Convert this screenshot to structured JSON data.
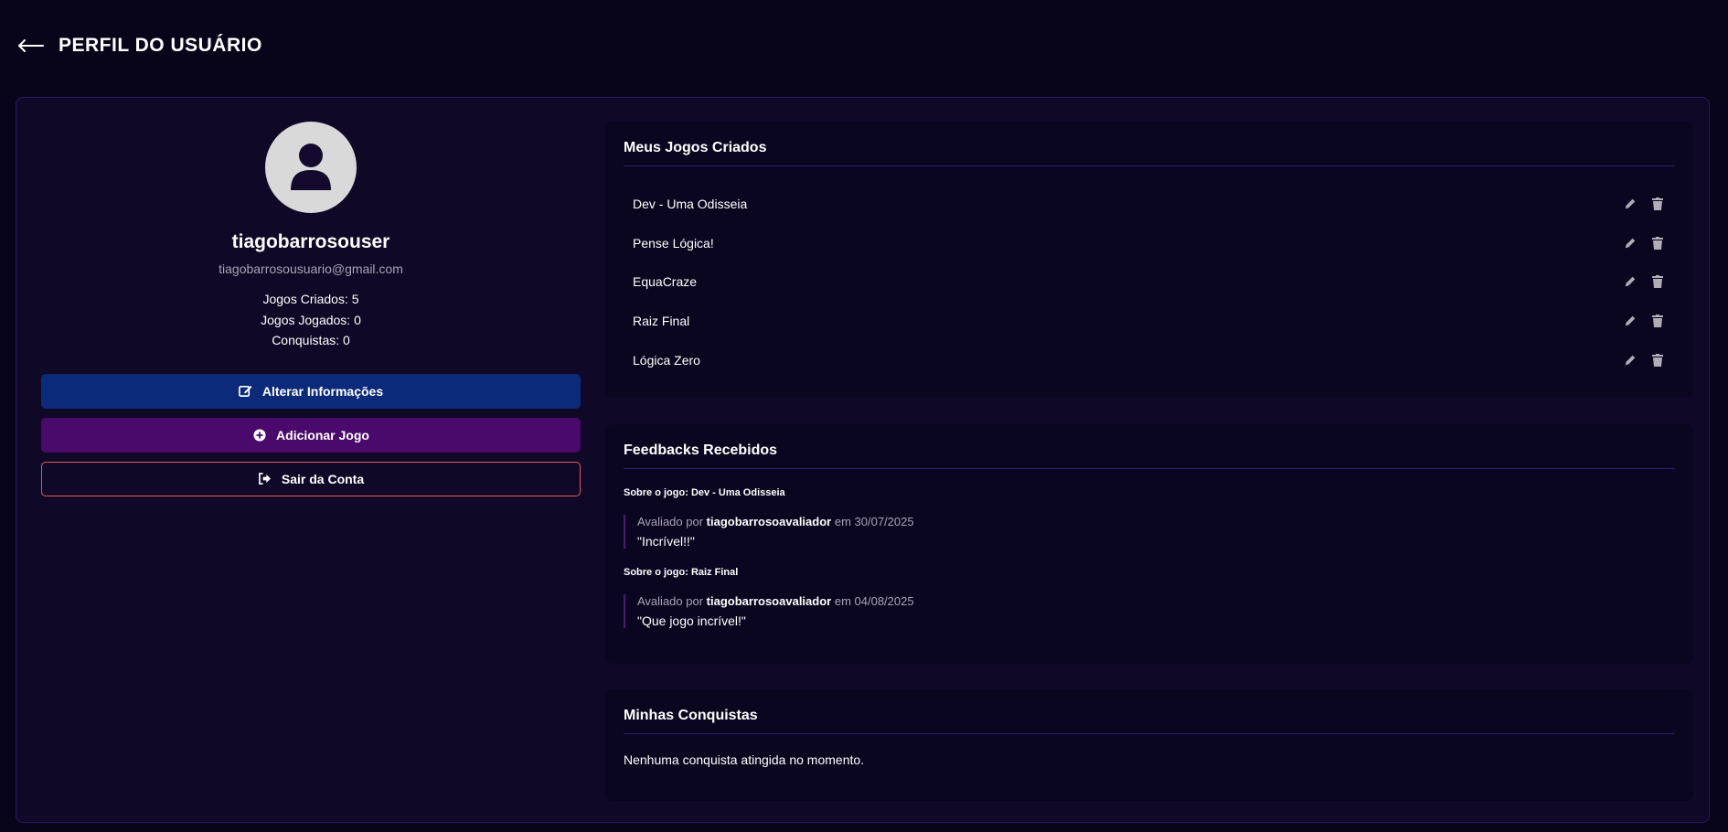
{
  "header": {
    "title": "PERFIL DO USUÁRIO"
  },
  "profile": {
    "username": "tiagobarrosouser",
    "email": "tiagobarrosousuario@gmail.com",
    "stats": {
      "created": "Jogos Criados: 5",
      "played": "Jogos Jogados: 0",
      "achievements": "Conquistas: 0"
    },
    "buttons": {
      "edit": "Alterar Informações",
      "add": "Adicionar Jogo",
      "logout": "Sair da Conta"
    }
  },
  "my_games": {
    "title": "Meus Jogos Criados",
    "items": [
      "Dev - Uma Odisseia",
      "Pense Lógica!",
      "EquaCraze",
      "Raiz Final",
      "Lógica Zero"
    ]
  },
  "feedbacks": {
    "title": "Feedbacks Recebidos",
    "groups": [
      {
        "about": "Sobre o jogo: Dev - Uma Odisseia",
        "prefix": "Avaliado por",
        "author": "tiagobarrosoavaliador",
        "date": "em 30/07/2025",
        "text": "\"Incrível!!\""
      },
      {
        "about": "Sobre o jogo: Raiz Final",
        "prefix": "Avaliado por",
        "author": "tiagobarrosoavaliador",
        "date": "em 04/08/2025",
        "text": "\"Que jogo incrível!\""
      }
    ]
  },
  "achievements": {
    "title": "Minhas Conquistas",
    "empty": "Nenhuma conquista atingida no momento."
  },
  "icons": {
    "back": "arrow-left-icon",
    "avatar": "user-icon",
    "edit": "pen-square-icon",
    "add": "plus-circle-icon",
    "logout": "sign-out-icon",
    "rename": "pencil-icon",
    "delete": "trash-icon"
  },
  "colors": {
    "background": "#08051a",
    "panel": "#0f0826",
    "edit_button": "#0c2a7a",
    "add_button": "#4a0a6b",
    "logout_border": "#e0585c"
  }
}
